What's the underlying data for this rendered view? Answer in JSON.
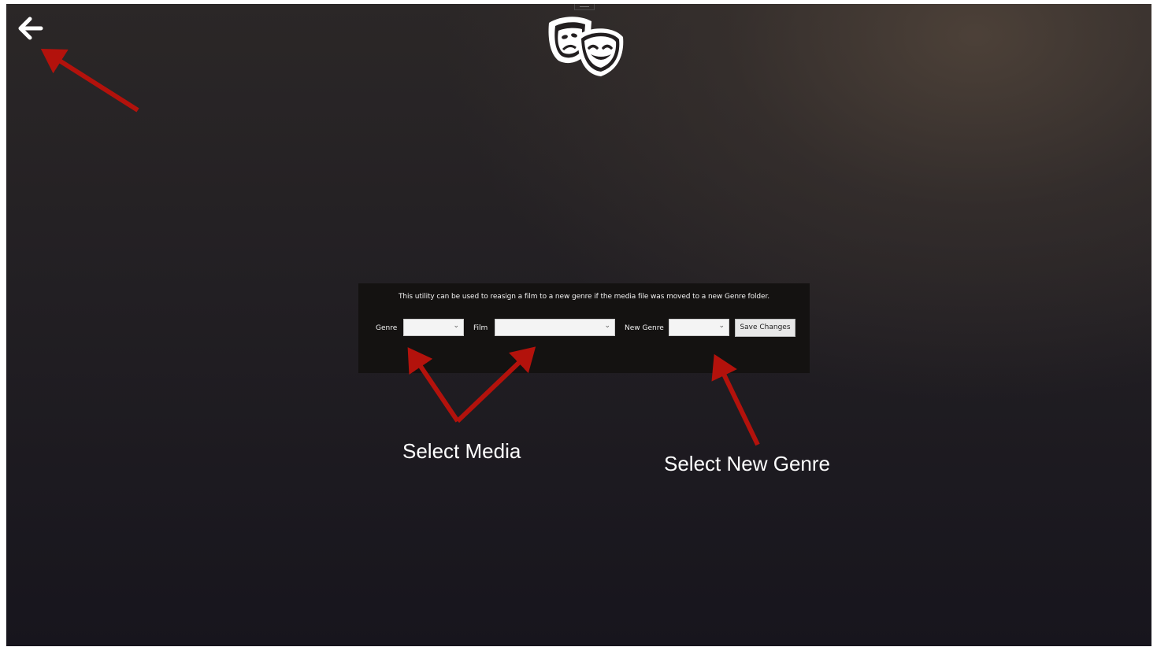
{
  "nav": {
    "back_icon": "arrow-left-icon"
  },
  "header": {
    "logo_icon": "theater-masks-icon"
  },
  "utility": {
    "description": "This utility can be used to reasign a film to a new genre if the media file was moved to a new Genre folder.",
    "genre_label": "Genre",
    "genre_value": "",
    "film_label": "Film",
    "film_value": "",
    "new_genre_label": "New Genre",
    "new_genre_value": "",
    "save_label": "Save Changes",
    "dropdown_icon": "chevron-down-icon"
  },
  "annotations": {
    "select_media": "Select Media",
    "select_new_genre": "Select New Genre",
    "arrow_color": "#b3120c"
  },
  "colors": {
    "panel_bg": "#141211",
    "text": "#f2f2f2"
  }
}
